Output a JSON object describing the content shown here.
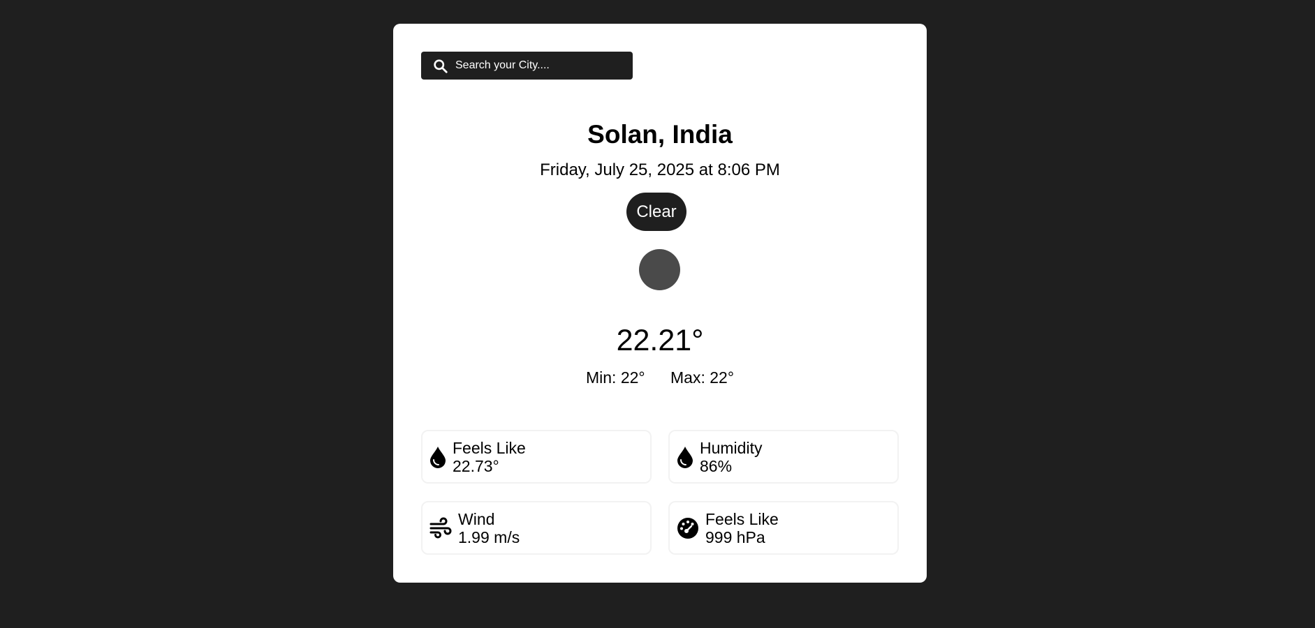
{
  "search": {
    "placeholder": "Search your City...."
  },
  "location": {
    "city": "Solan, India"
  },
  "datetime": "Friday, July 25, 2025 at 8:06 PM",
  "condition": "Clear",
  "temperature": "22.21°",
  "minmax": {
    "min": "Min: 22°",
    "max": "Max: 22°"
  },
  "details": [
    {
      "label": "Feels Like",
      "value": "22.73°",
      "icon": "water-drop-icon"
    },
    {
      "label": "Humidity",
      "value": "86%",
      "icon": "water-drop-icon"
    },
    {
      "label": "Wind",
      "value": "1.99 m/s",
      "icon": "wind-icon"
    },
    {
      "label": "Feels Like",
      "value": "999 hPa",
      "icon": "gauge-icon"
    }
  ],
  "colors": {
    "background": "#1f1f1f",
    "card": "#ffffff",
    "accent": "#1f1f1f",
    "weather_icon": "#4a4a4a"
  }
}
